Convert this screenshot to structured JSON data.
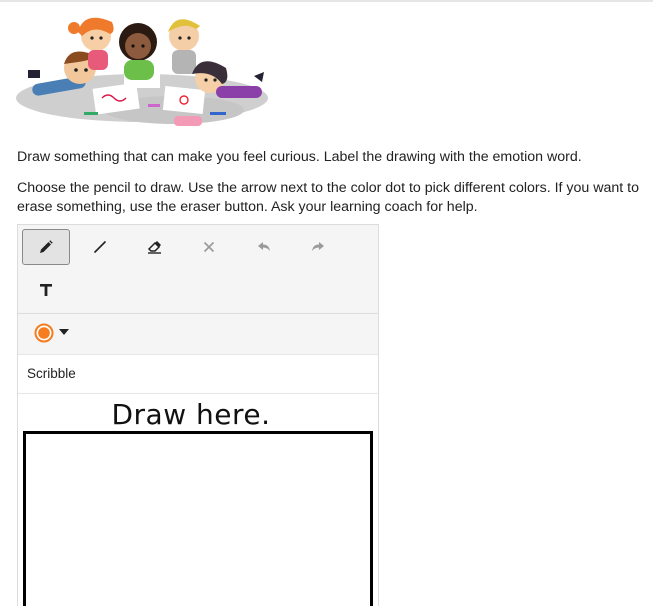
{
  "instructions": {
    "prompt": "Draw something that can make you feel curious. Label the drawing with the emotion word.",
    "help": "Choose the pencil to draw. Use the arrow next to the color dot to pick different colors. If you want to erase something, use the eraser button. Ask your learning coach for help."
  },
  "toolbar": {
    "tools": [
      {
        "icon": "pencil-icon",
        "active": true
      },
      {
        "icon": "line-icon",
        "active": false
      },
      {
        "icon": "eraser-icon",
        "active": false
      },
      {
        "icon": "clear-icon",
        "active": false,
        "disabled": true
      },
      {
        "icon": "undo-icon",
        "active": false,
        "disabled": true
      },
      {
        "icon": "redo-icon",
        "active": false,
        "disabled": true
      },
      {
        "icon": "text-icon",
        "active": false
      }
    ]
  },
  "color_picker": {
    "current_color": "#f57c1f"
  },
  "mode": {
    "label": "Scribble"
  },
  "canvas": {
    "title": "Draw here."
  },
  "colors": {
    "toolbar_bg": "#f5f5f5",
    "active_tool_border": "#8a8a8a",
    "disabled_icon": "#9a9a9a"
  }
}
